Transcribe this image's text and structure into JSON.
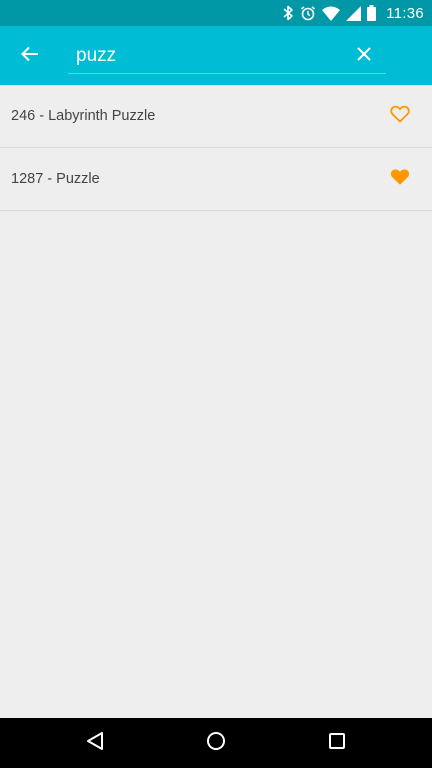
{
  "status_bar": {
    "time": "11:36",
    "icons": [
      "bluetooth-icon",
      "alarm-icon",
      "wifi-icon",
      "signal-icon",
      "battery-icon"
    ]
  },
  "toolbar": {
    "search_value": "puzz",
    "background_color": "#00bcd4"
  },
  "results": [
    {
      "label": "246 - Labyrinth Puzzle",
      "favorite": false
    },
    {
      "label": "1287 - Puzzle",
      "favorite": true
    }
  ],
  "colors": {
    "accent": "#ff9800",
    "status_bar": "#0097a7"
  },
  "nav_bar": {
    "icons": [
      "back-triangle-icon",
      "home-circle-icon",
      "recents-square-icon"
    ]
  }
}
